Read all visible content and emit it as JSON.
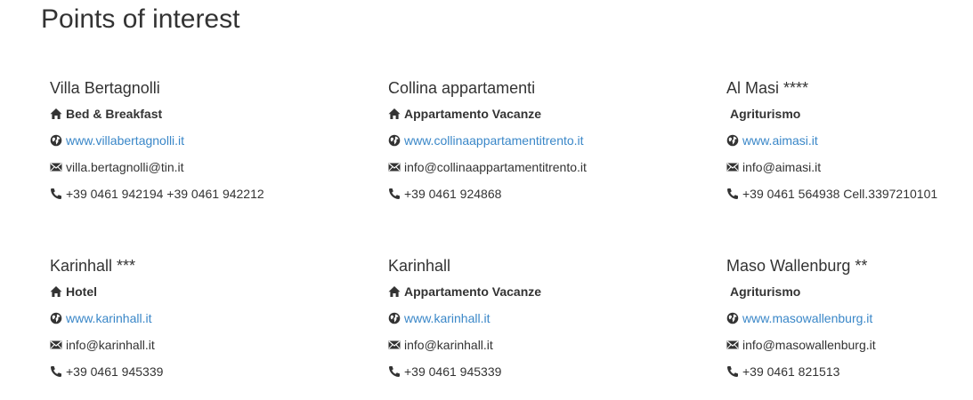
{
  "page": {
    "title": "Points of interest"
  },
  "pois": [
    {
      "name": "Villa Bertagnolli",
      "type": "Bed & Breakfast",
      "type_icon": "home-icon",
      "website": "www.villabertagnolli.it",
      "email": "villa.bertagnolli@tin.it",
      "phone": "+39 0461 942194 +39 0461 942212"
    },
    {
      "name": "Collina appartamenti",
      "type": "Appartamento Vacanze",
      "type_icon": "home-icon",
      "website": "www.collinaappartamentitrento.it",
      "email": "info@collinaappartamentitrento.it",
      "phone": "+39 0461 924868"
    },
    {
      "name": "Al Masi ****",
      "type": "Agriturismo",
      "type_icon": "",
      "website": "www.aimasi.it",
      "email": "info@aimasi.it",
      "phone": "+39 0461 564938 Cell.3397210101"
    },
    {
      "name": "Karinhall ***",
      "type": "Hotel",
      "type_icon": "home-icon",
      "website": "www.karinhall.it",
      "email": "info@karinhall.it",
      "phone": "+39 0461 945339"
    },
    {
      "name": "Karinhall",
      "type": "Appartamento Vacanze",
      "type_icon": "home-icon",
      "website": "www.karinhall.it",
      "email": "info@karinhall.it",
      "phone": "+39 0461 945339"
    },
    {
      "name": "Maso Wallenburg **",
      "type": "Agriturismo",
      "type_icon": "",
      "website": "www.masowallenburg.it",
      "email": "info@masowallenburg.it",
      "phone": "+39 0461 821513"
    }
  ],
  "colors": {
    "link": "#3a87c8",
    "text": "#333333"
  }
}
